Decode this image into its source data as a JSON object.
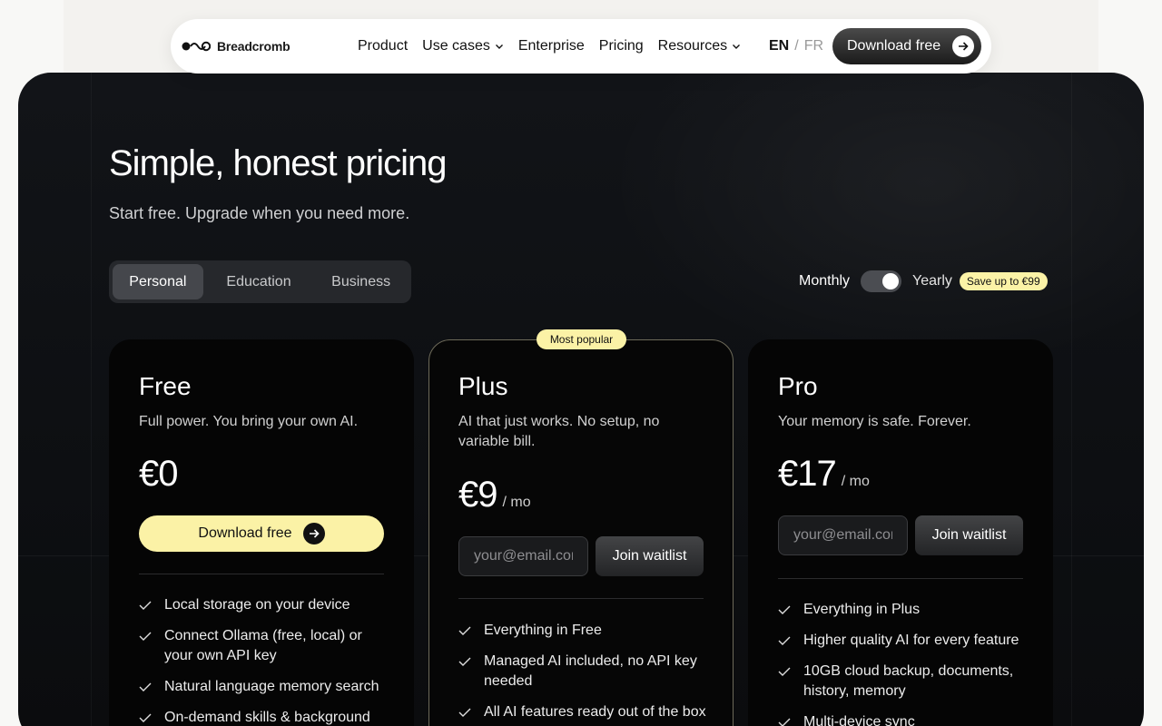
{
  "nav": {
    "logo_text": "Breadcromb",
    "menu": [
      {
        "label": "Product",
        "has_dropdown": false
      },
      {
        "label": "Use cases",
        "has_dropdown": true
      },
      {
        "label": "Enterprise",
        "has_dropdown": false
      },
      {
        "label": "Pricing",
        "has_dropdown": false
      },
      {
        "label": "Resources",
        "has_dropdown": true
      }
    ],
    "lang_active": "EN",
    "lang_sep": "/",
    "lang_other": "FR",
    "download_label": "Download free"
  },
  "hero": {
    "title": "Simple, honest pricing",
    "subtitle": "Start free. Upgrade when you need more."
  },
  "segments": [
    {
      "label": "Personal",
      "active": true
    },
    {
      "label": "Education",
      "active": false
    },
    {
      "label": "Business",
      "active": false
    }
  ],
  "billing": {
    "monthly_label": "Monthly",
    "yearly_label": "Yearly",
    "save_badge": "Save up to €99",
    "yearly_selected": true
  },
  "plans": {
    "free": {
      "name": "Free",
      "desc": "Full power. You bring your own AI.",
      "price": "€0",
      "cta": "Download free",
      "features": [
        "Local storage on your device",
        "Connect Ollama (free, local) or your own API key",
        "Natural language memory search",
        "On-demand skills & background"
      ]
    },
    "plus": {
      "badge": "Most popular",
      "name": "Plus",
      "desc": "AI that just works. No setup, no variable bill.",
      "price": "€9",
      "per": "/ mo",
      "email_placeholder": "your@email.com",
      "cta": "Join waitlist",
      "features": [
        "Everything in Free",
        "Managed AI included, no API key needed",
        "All AI features ready out of the box"
      ]
    },
    "pro": {
      "name": "Pro",
      "desc": "Your memory is safe. Forever.",
      "price": "€17",
      "per": "/ mo",
      "email_placeholder": "your@email.com",
      "cta": "Join waitlist",
      "features": [
        "Everything in Plus",
        "Higher quality AI for every feature",
        "10GB cloud backup, documents, history, memory",
        "Multi-device sync"
      ]
    }
  },
  "colors": {
    "accent_yellow": "#fbf2a6",
    "panel_dark": "#0d0f12",
    "card_bg": "#050505"
  }
}
